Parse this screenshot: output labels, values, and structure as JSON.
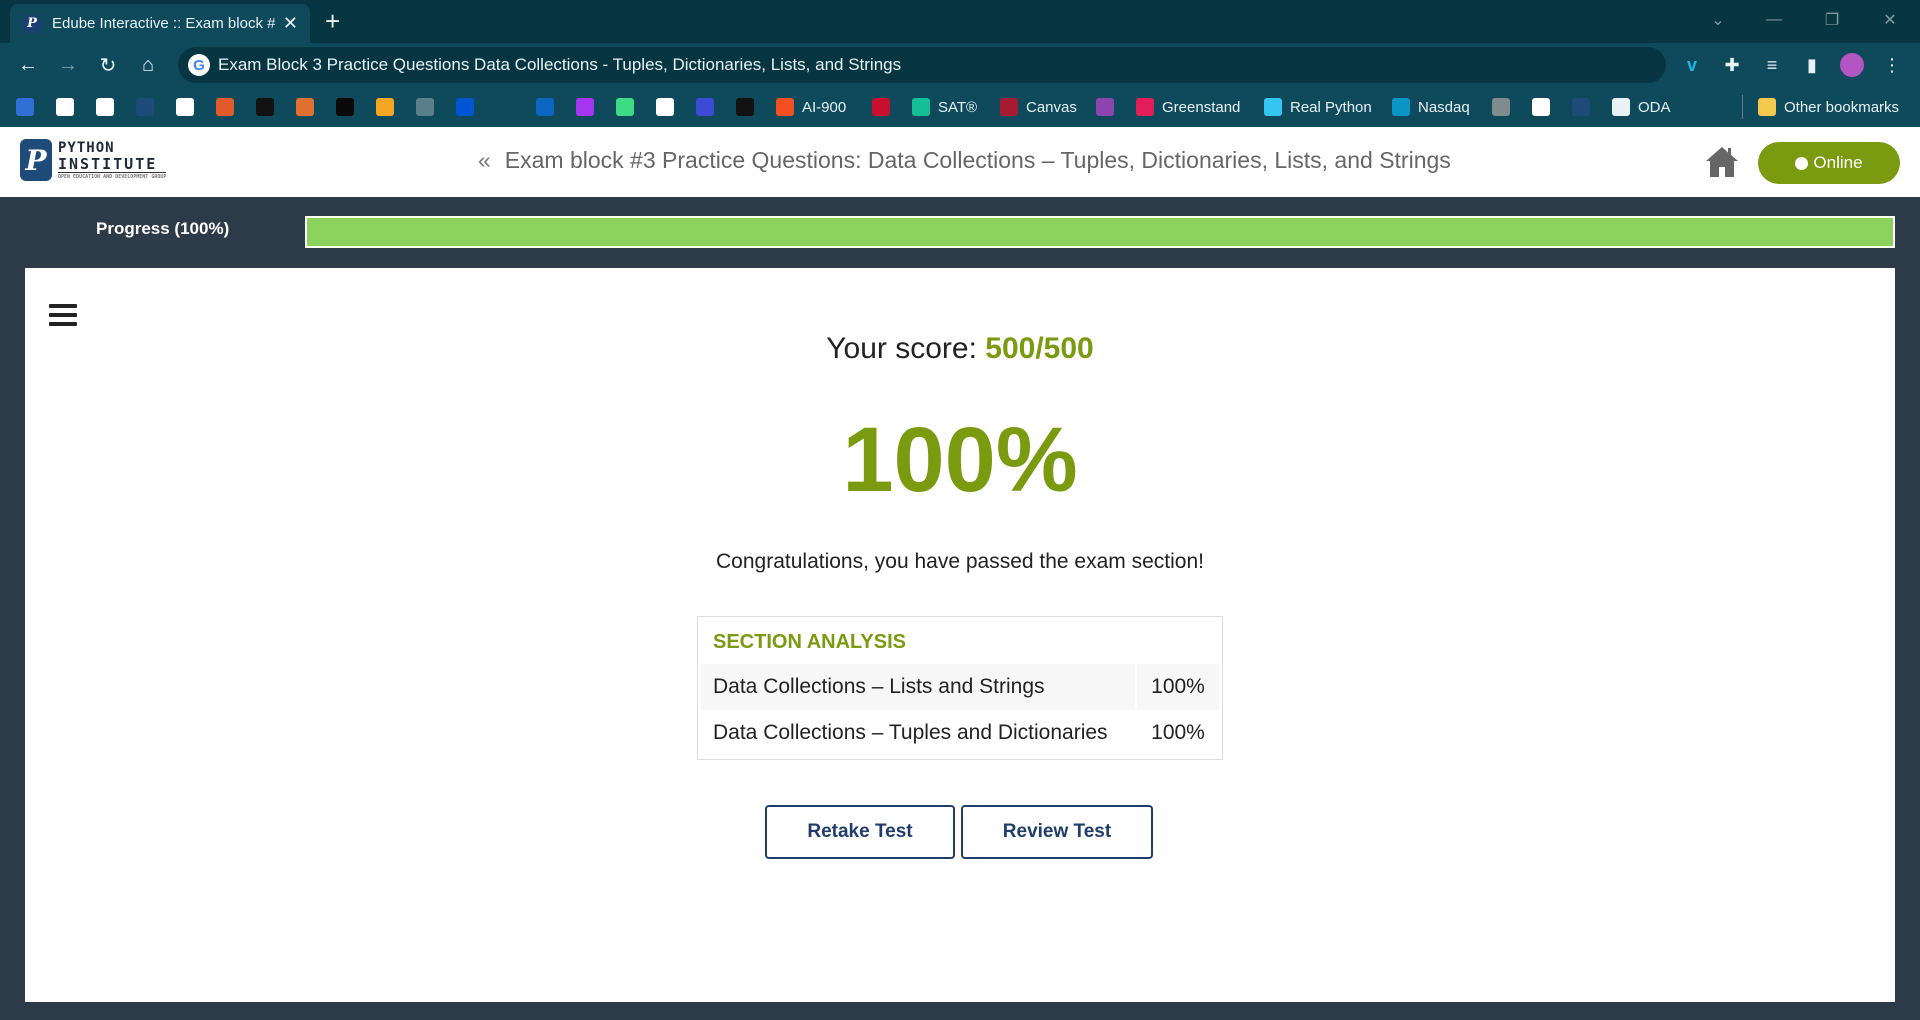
{
  "browser": {
    "tab_title": "Edube Interactive :: Exam block #",
    "new_tab": "+",
    "close_tab": "✕",
    "url": "Exam Block 3 Practice Questions Data Collections - Tuples, Dictionaries, Lists, and Strings"
  },
  "bookmarks": [
    {
      "label": "",
      "icon": "stack-icon",
      "color": "#2f6fd6"
    },
    {
      "label": "",
      "icon": "github-icon",
      "color": "#ffffff"
    },
    {
      "label": "",
      "icon": "circle-logo-icon",
      "color": "#ffffff"
    },
    {
      "label": "",
      "icon": "app-icon",
      "color": "#1f4b7a"
    },
    {
      "label": "",
      "icon": "printer-icon",
      "color": "#ffffff"
    },
    {
      "label": "",
      "icon": "swirl-icon",
      "color": "#e05a2b"
    },
    {
      "label": "",
      "icon": "lambda-icon",
      "color": "#111111"
    },
    {
      "label": "",
      "icon": "slash-icon",
      "color": "#e07030"
    },
    {
      "label": "",
      "icon": "hackerrank-icon",
      "color": "#0a0a0a"
    },
    {
      "label": "",
      "icon": "leetcode-icon",
      "color": "#f5a623"
    },
    {
      "label": "",
      "icon": "dots-icon",
      "color": "#5a7f8a"
    },
    {
      "label": "",
      "icon": "coursera-icon",
      "color": "#0056d2"
    },
    {
      "label": "",
      "icon": "edx-icon",
      "color": "#0e4a5c"
    },
    {
      "label": "",
      "icon": "linkedin-icon",
      "color": "#0a66c2"
    },
    {
      "label": "",
      "icon": "udemy-icon",
      "color": "#a435f0"
    },
    {
      "label": "",
      "icon": "android-icon",
      "color": "#3ddc84"
    },
    {
      "label": "",
      "icon": "code-icon",
      "color": "#ffffff"
    },
    {
      "label": "",
      "icon": "bracket-icon",
      "color": "#3b4bd6"
    },
    {
      "label": "",
      "icon": "terminal-icon",
      "color": "#111111"
    },
    {
      "label": "AI-900",
      "icon": "microsoft-icon",
      "color": "#f25022"
    },
    {
      "label": "",
      "icon": "shield-icon",
      "color": "#c8102e"
    },
    {
      "label": "SAT®",
      "icon": "khan-icon",
      "color": "#14bf96"
    },
    {
      "label": "Canvas",
      "icon": "harvard-icon",
      "color": "#a51c30"
    },
    {
      "label": "",
      "icon": "ed-icon",
      "color": "#8e44ad"
    },
    {
      "label": "Greenstand",
      "icon": "slack-icon",
      "color": "#e01e5a"
    },
    {
      "label": "Real Python",
      "icon": "slack-icon",
      "color": "#36c5f0"
    },
    {
      "label": "Nasdaq",
      "icon": "chart-icon",
      "color": "#0996c7"
    },
    {
      "label": "",
      "icon": "aai-icon",
      "color": "#7f8c8d"
    },
    {
      "label": "",
      "icon": "mw-icon",
      "color": "#ffffff"
    },
    {
      "label": "",
      "icon": "python-institute-icon",
      "color": "#1f4b7a"
    },
    {
      "label": "ODA",
      "icon": "openai-icon",
      "color": "#e8f2f4"
    }
  ],
  "other_bookmarks": "Other bookmarks",
  "header": {
    "logo_line1": "PYTHON",
    "logo_line2": "INSTITUTE",
    "logo_tagline": "OPEN EDUCATION AND DEVELOPMENT GROUP",
    "back_chevron": "«",
    "title": "Exam block #3 Practice Questions: Data Collections – Tuples, Dictionaries, Lists, and Strings",
    "online_label": "Online"
  },
  "progress": {
    "label": "Progress (100%)",
    "value": 1.0
  },
  "result": {
    "score_label": "Your score: ",
    "score_value": "500/500",
    "percentage": "100%",
    "message": "Congratulations, you have passed the exam section!"
  },
  "analysis": {
    "heading": "SECTION ANALYSIS",
    "rows": [
      {
        "name": "Data Collections – Lists and Strings",
        "value": "100%"
      },
      {
        "name": "Data Collections – Tuples and Dictionaries",
        "value": "100%"
      }
    ]
  },
  "buttons": {
    "retake": "Retake Test",
    "review": "Review Test"
  },
  "colors": {
    "accent": "#7a9a10",
    "progress_fill": "#8bd35c",
    "button_text": "#1f3e6b",
    "chrome_bg": "#0e4a5c"
  }
}
